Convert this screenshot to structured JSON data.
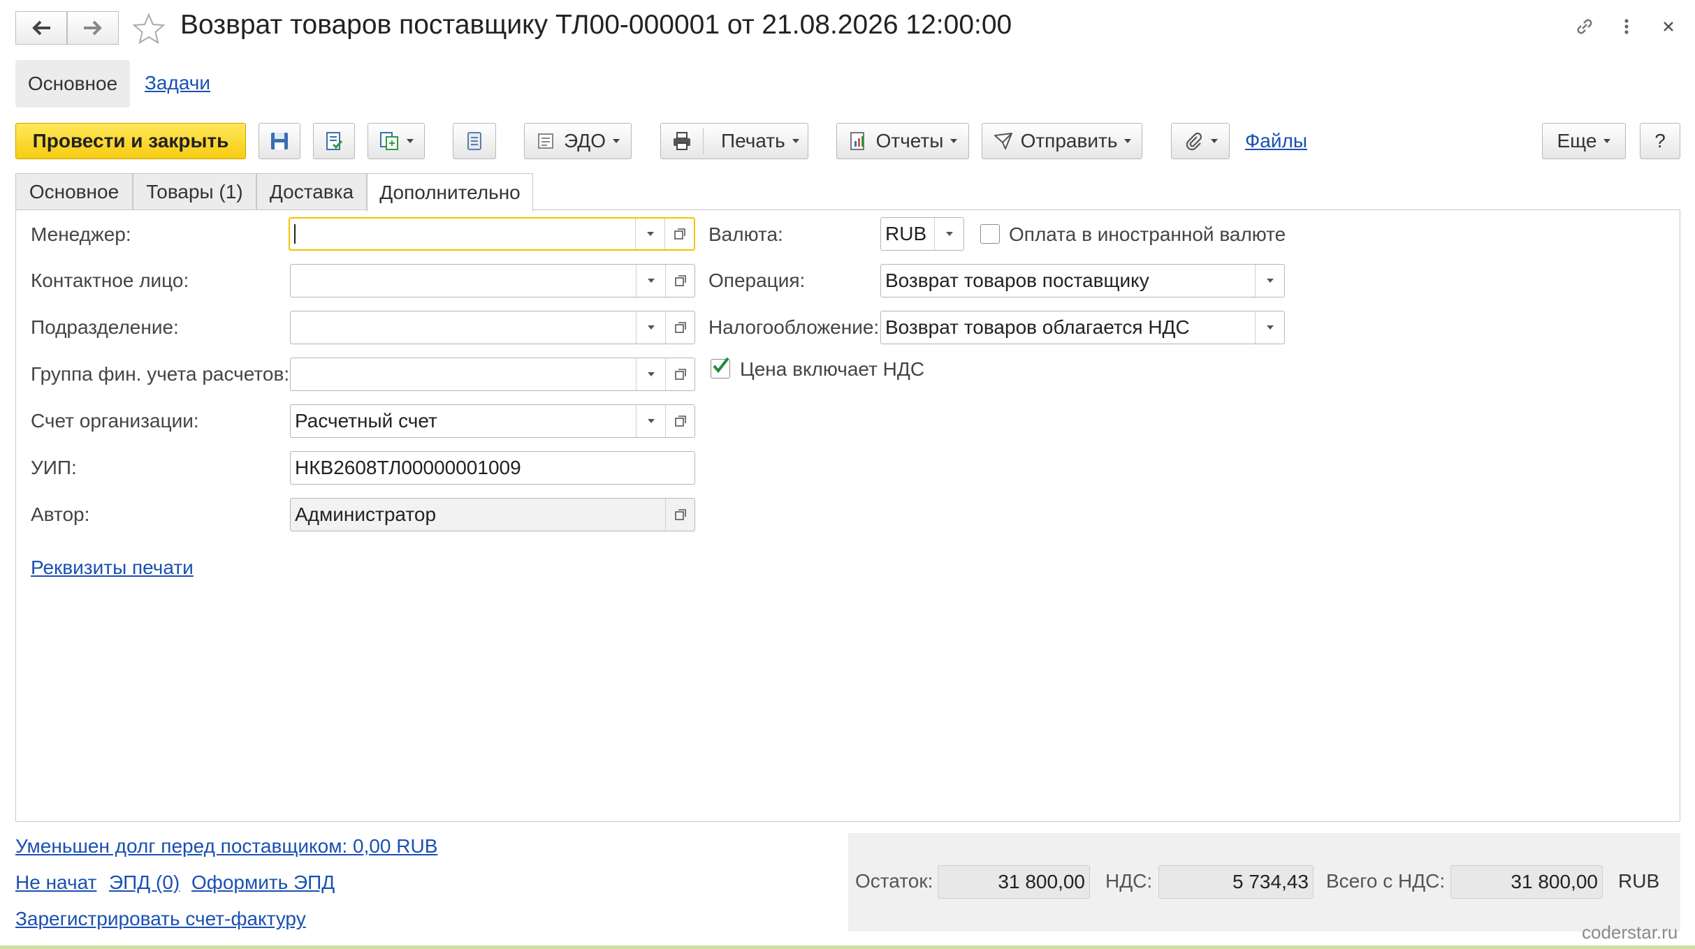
{
  "window": {
    "title": "Возврат товаров поставщику ТЛ00-000001 от 21.08.2026 12:00:00"
  },
  "section_tabs": [
    "Основное",
    "Задачи"
  ],
  "toolbar": {
    "post_close": "Провести и закрыть",
    "edo": "ЭДО",
    "print": "Печать",
    "reports": "Отчеты",
    "send": "Отправить",
    "files": "Файлы",
    "more": "Еще",
    "help": "?"
  },
  "tabs": [
    "Основное",
    "Товары (1)",
    "Доставка",
    "Дополнительно"
  ],
  "left_fields": [
    {
      "label": "Менеджер:",
      "value": ""
    },
    {
      "label": "Контактное лицо:",
      "value": ""
    },
    {
      "label": "Подразделение:",
      "value": ""
    },
    {
      "label": "Группа фин. учета расчетов:",
      "value": ""
    },
    {
      "label": "Счет организации:",
      "value": "Расчетный счет"
    },
    {
      "label": "УИП:",
      "value": "НКВ2608ТЛ00000001009"
    },
    {
      "label": "Автор:",
      "value": "Администратор"
    }
  ],
  "print_requisites_link": "Реквизиты печати",
  "right_fields": {
    "currency_label": "Валюта:",
    "currency_value": "RUB",
    "foreign_payment_label": "Оплата в иностранной валюте",
    "foreign_payment_checked": false,
    "operation_label": "Операция:",
    "operation_value": "Возврат товаров поставщику",
    "taxation_label": "Налогообложение:",
    "taxation_value": "Возврат товаров облагается НДС",
    "price_incl_vat_label": "Цена включает НДС",
    "price_incl_vat_checked": true
  },
  "footer": {
    "debt_link": "Уменьшен долг перед поставщиком: 0,00 RUB",
    "status_link": "Не начат",
    "epd_link": "ЭПД (0)",
    "make_epd_link": "Оформить ЭПД",
    "register_invoice_link": "Зарегистрировать счет-фактуру"
  },
  "totals": {
    "balance_label": "Остаток:",
    "balance_value": "31 800,00",
    "vat_label": "НДС:",
    "vat_value": "5 734,43",
    "total_label": "Всего с НДС:",
    "total_value": "31 800,00",
    "currency": "RUB"
  },
  "watermark": "coderstar.ru",
  "colors": {
    "primary_button": "#f7cc12",
    "link": "#1a50b3",
    "focus_border": "#f2c400",
    "checkmark": "#1e8a3c"
  }
}
